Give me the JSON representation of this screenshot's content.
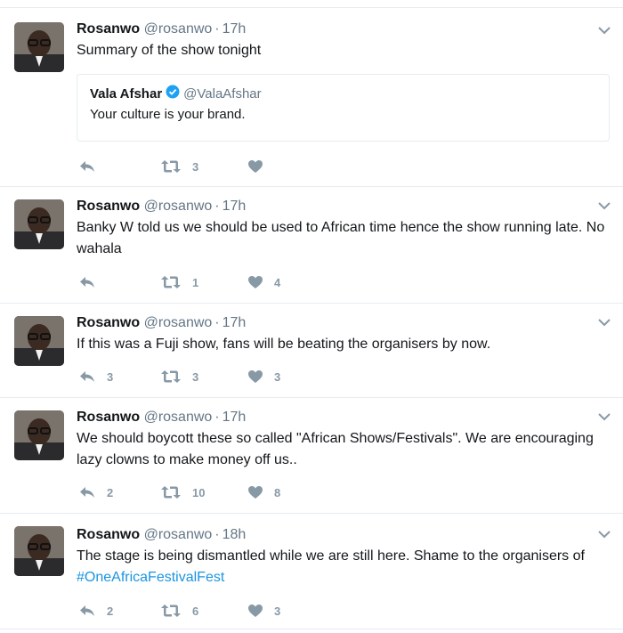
{
  "tweets": [
    {
      "name": "Rosanwo",
      "handle": "@rosanwo",
      "separator": "·",
      "time": "17h",
      "text": "Summary of the show tonight",
      "hashtag": "",
      "quote": {
        "name": "Vala Afshar",
        "handle": "@ValaAfshar",
        "text": "Your culture is your brand.",
        "verified": true
      },
      "replies": "",
      "retweets": "3",
      "likes": ""
    },
    {
      "name": "Rosanwo",
      "handle": "@rosanwo",
      "separator": "·",
      "time": "17h",
      "text": "Banky W told us we should be used to African time hence the show running late. No wahala",
      "hashtag": "",
      "replies": "",
      "retweets": "1",
      "likes": "4"
    },
    {
      "name": "Rosanwo",
      "handle": "@rosanwo",
      "separator": "·",
      "time": "17h",
      "text": "If this was a Fuji show, fans will be beating the organisers by now.",
      "hashtag": "",
      "replies": "3",
      "retweets": "3",
      "likes": "3"
    },
    {
      "name": "Rosanwo",
      "handle": "@rosanwo",
      "separator": "·",
      "time": "17h",
      "text": "We should boycott these so called \"African Shows/Festivals\". We are encouraging lazy clowns to make money off us..",
      "hashtag": "",
      "replies": "2",
      "retweets": "10",
      "likes": "8"
    },
    {
      "name": "Rosanwo",
      "handle": "@rosanwo",
      "separator": "·",
      "time": "18h",
      "text": "The stage is being dismantled while we are still here. Shame to the organisers of",
      "hashtag": "#OneAfricaFestivalFest",
      "replies": "2",
      "retweets": "6",
      "likes": "3"
    }
  ],
  "colors": {
    "link": "#1b95e0",
    "muted": "#657786",
    "icon": "#8899a6",
    "verified": "#1da1f2",
    "border": "#e6ecf0"
  },
  "icons": [
    "avatar",
    "chevron-down-icon",
    "reply-icon",
    "retweet-icon",
    "heart-icon",
    "verified-badge-icon"
  ]
}
